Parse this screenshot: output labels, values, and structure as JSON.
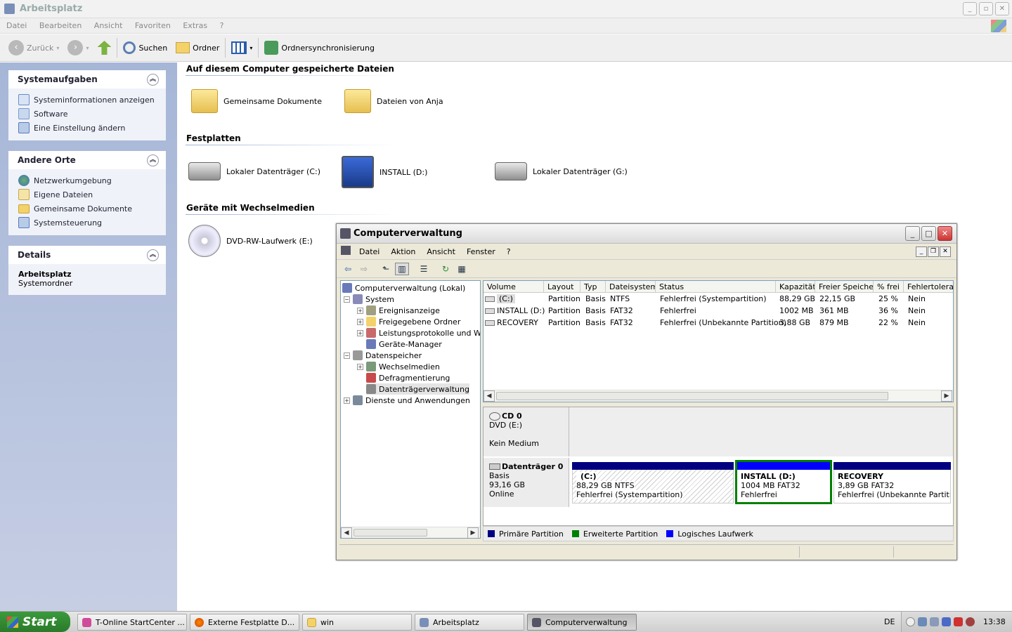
{
  "explorer": {
    "title": "Arbeitsplatz",
    "menu": [
      "Datei",
      "Bearbeiten",
      "Ansicht",
      "Favoriten",
      "Extras",
      "?"
    ],
    "toolbar": {
      "back": "Zurück",
      "search": "Suchen",
      "folders": "Ordner",
      "sync": "Ordnersynchronisierung"
    },
    "panels": {
      "system_tasks": {
        "title": "Systemaufgaben",
        "items": [
          "Systeminformationen anzeigen",
          "Software",
          "Eine Einstellung ändern"
        ]
      },
      "other_places": {
        "title": "Andere Orte",
        "items": [
          "Netzwerkumgebung",
          "Eigene Dateien",
          "Gemeinsame Dokumente",
          "Systemsteuerung"
        ]
      },
      "details": {
        "title": "Details",
        "name": "Arbeitsplatz",
        "type": "Systemordner"
      }
    },
    "sections": {
      "stored_files": {
        "title": "Auf diesem Computer gespeicherte Dateien",
        "items": [
          "Gemeinsame Dokumente",
          "Dateien von Anja"
        ]
      },
      "hard_disks": {
        "title": "Festplatten",
        "items": [
          "Lokaler Datenträger (C:)",
          "INSTALL (D:)",
          "Lokaler Datenträger (G:)"
        ]
      },
      "removable": {
        "title": "Geräte mit Wechselmedien",
        "items": [
          "DVD-RW-Laufwerk (E:)"
        ]
      }
    }
  },
  "compmgmt": {
    "title": "Computerverwaltung",
    "menu": [
      "Datei",
      "Aktion",
      "Ansicht",
      "Fenster",
      "?"
    ],
    "tree": {
      "root": "Computerverwaltung (Lokal)",
      "system": "System",
      "event_viewer": "Ereignisanzeige",
      "shared_folders": "Freigegebene Ordner",
      "perf_logs": "Leistungsprotokolle und Warn",
      "device_manager": "Geräte-Manager",
      "storage": "Datenspeicher",
      "removable_storage": "Wechselmedien",
      "defrag": "Defragmentierung",
      "disk_mgmt": "Datenträgerverwaltung",
      "services": "Dienste und Anwendungen"
    },
    "volume_columns": [
      "Volume",
      "Layout",
      "Typ",
      "Dateisystem",
      "Status",
      "Kapazität",
      "Freier Speicher",
      "% frei",
      "Fehlertoleranz"
    ],
    "volumes": [
      {
        "volume": "(C:)",
        "layout": "Partition",
        "type": "Basis",
        "fs": "NTFS",
        "status": "Fehlerfrei (Systempartition)",
        "capacity": "88,29 GB",
        "free": "22,15 GB",
        "pct": "25 %",
        "ft": "Nein"
      },
      {
        "volume": "INSTALL (D:)",
        "layout": "Partition",
        "type": "Basis",
        "fs": "FAT32",
        "status": "Fehlerfrei",
        "capacity": "1002 MB",
        "free": "361 MB",
        "pct": "36 %",
        "ft": "Nein"
      },
      {
        "volume": "RECOVERY",
        "layout": "Partition",
        "type": "Basis",
        "fs": "FAT32",
        "status": "Fehlerfrei (Unbekannte Partition)",
        "capacity": "3,88 GB",
        "free": "879 MB",
        "pct": "22 %",
        "ft": "Nein"
      }
    ],
    "cd0": {
      "name": "CD 0",
      "type": "DVD (E:)",
      "media": "Kein Medium"
    },
    "disk0": {
      "name": "Datenträger 0",
      "type": "Basis",
      "size": "93,16 GB",
      "state": "Online",
      "partitions": [
        {
          "name": "(C:)",
          "size": "88,29 GB NTFS",
          "status": "Fehlerfrei (Systempartition)"
        },
        {
          "name": "INSTALL  (D:)",
          "size": "1004 MB FAT32",
          "status": "Fehlerfrei"
        },
        {
          "name": "RECOVERY",
          "size": "3,89 GB FAT32",
          "status": "Fehlerfrei (Unbekannte Partition"
        }
      ]
    },
    "legend": [
      {
        "label": "Primäre Partition",
        "color": "#000080"
      },
      {
        "label": "Erweiterte Partition",
        "color": "#008000"
      },
      {
        "label": "Logisches Laufwerk",
        "color": "#0000ff"
      }
    ]
  },
  "taskbar": {
    "start": "Start",
    "tasks": [
      "T-Online StartCenter ...",
      "Externe Festplatte D...",
      "win",
      "Arbeitsplatz",
      "Computerverwaltung"
    ],
    "lang": "DE",
    "clock": "13:38"
  }
}
